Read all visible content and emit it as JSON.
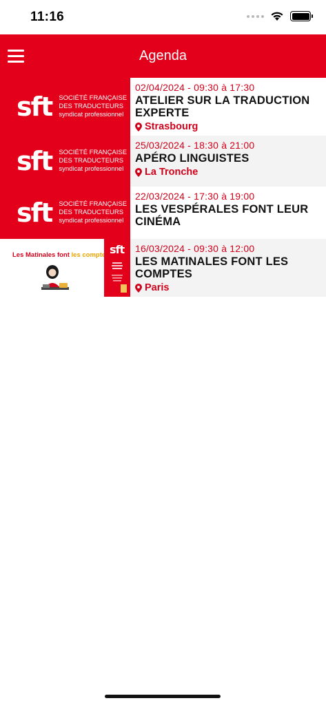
{
  "status_bar": {
    "time": "11:16"
  },
  "nav": {
    "title": "Agenda"
  },
  "logo": {
    "mark": "sft",
    "line1": "SOCIÉTÉ FRANÇAISE",
    "line2": "DES TRADUCTEURS",
    "line3": "syndicat professionnel"
  },
  "events": [
    {
      "date": "02/04/2024 - 09:30 à 17:30",
      "title": "ATELIER SUR LA TRADUCTION EXPERTE",
      "location": "Strasbourg"
    },
    {
      "date": "25/03/2024 - 18:30 à 21:00",
      "title": "APÉRO LINGUISTES",
      "location": "La Tronche"
    },
    {
      "date": "22/03/2024 - 17:30 à 19:00",
      "title": "LES VESPÉRALES FONT LEUR CINÉMA",
      "location": ""
    },
    {
      "date": "16/03/2024 - 09:30 à 12:00",
      "title": "LES MATINALES FONT LES COMPTES",
      "location": "Paris"
    }
  ],
  "poster": {
    "part1": "Les Matinales ",
    "part2": "font ",
    "part3": "les comptes !",
    "mini_logo": "sft"
  },
  "colors": {
    "brand_red": "#e2001a",
    "accent_red": "#d0021b"
  }
}
